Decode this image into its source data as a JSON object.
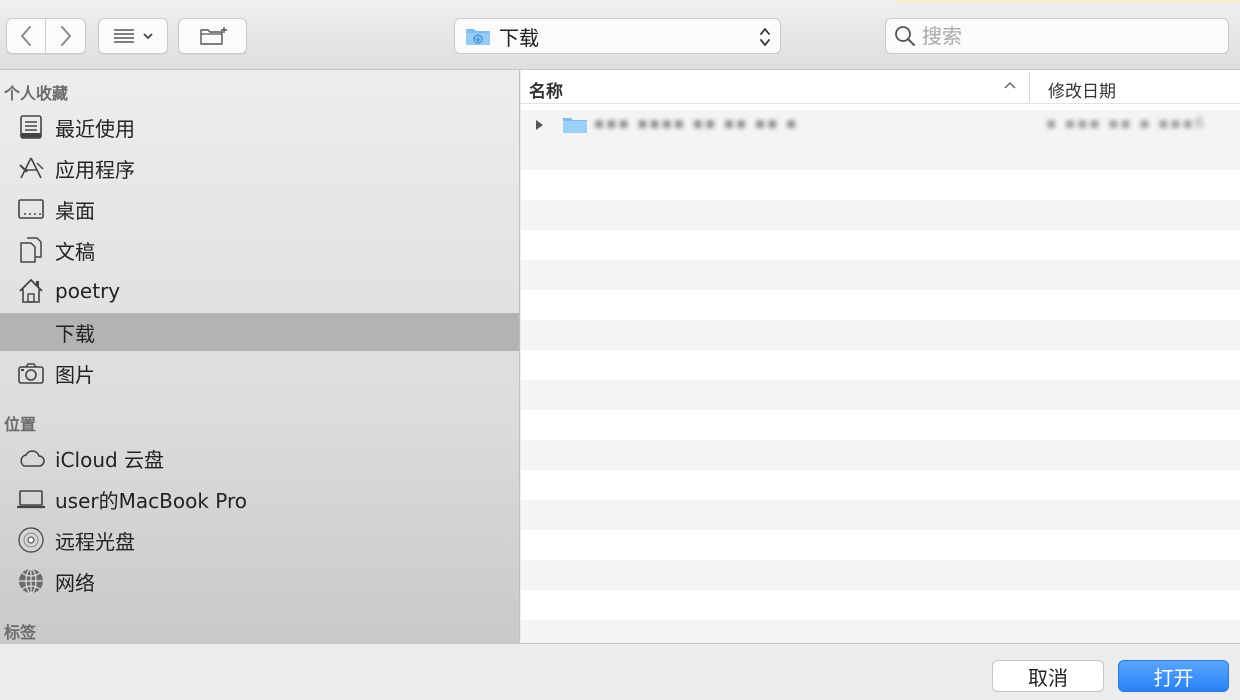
{
  "toolbar": {
    "nav_back_icon": "chevron-left-icon",
    "nav_forward_icon": "chevron-right-icon",
    "view_icon": "list-view-icon",
    "new_folder_icon": "new-folder-icon",
    "location": "下载",
    "search_placeholder": "搜索"
  },
  "sidebar": {
    "favorites_title": "个人收藏",
    "favorites": [
      {
        "label": "最近使用",
        "icon": "recents-icon"
      },
      {
        "label": "应用程序",
        "icon": "applications-icon"
      },
      {
        "label": "桌面",
        "icon": "desktop-icon"
      },
      {
        "label": "文稿",
        "icon": "documents-icon"
      },
      {
        "label": "poetry",
        "icon": "home-icon"
      },
      {
        "label": "下载",
        "icon": "downloads-icon",
        "selected": true
      },
      {
        "label": "图片",
        "icon": "pictures-icon"
      }
    ],
    "locations_title": "位置",
    "locations": [
      {
        "label": "iCloud 云盘",
        "icon": "icloud-icon"
      },
      {
        "label": "user的MacBook Pro",
        "icon": "laptop-icon"
      },
      {
        "label": "远程光盘",
        "icon": "remote-disc-icon"
      },
      {
        "label": "网络",
        "icon": "network-icon"
      }
    ],
    "tags_title": "标签"
  },
  "list": {
    "col_name": "名称",
    "col_date": "修改日期",
    "rows": [
      {
        "name": "▪▪▪ ▪▪▪▪  ▪▪ ▪▪ ▪▪ ▪",
        "date": "▪  ▪▪▪ ▪▪ ▪  ▪▪▪6"
      }
    ]
  },
  "footer": {
    "cancel": "取消",
    "open": "打开"
  },
  "colors": {
    "accent": "#2a82f5",
    "selection": "#b3b3b3",
    "folder": "#7fbcf0"
  }
}
